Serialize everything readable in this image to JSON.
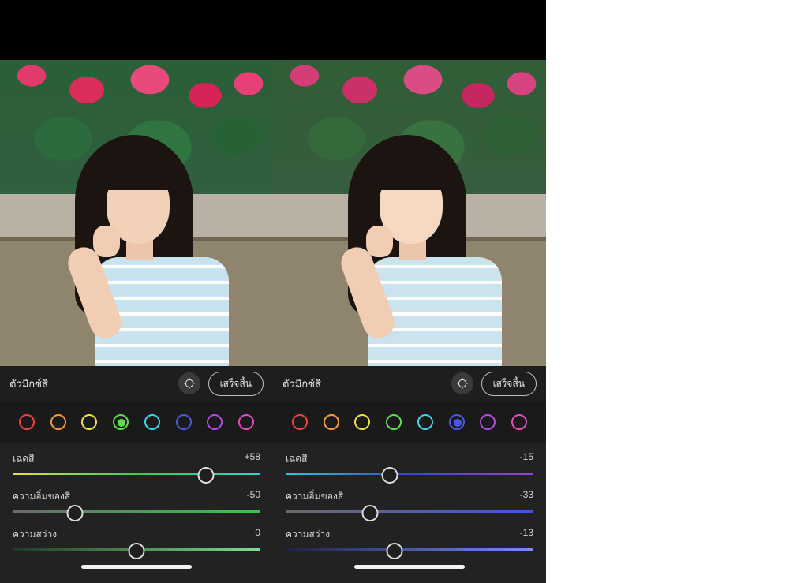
{
  "panes": [
    {
      "title": "ตัวมิกซ์สี",
      "done_label": "เสร็จสิ้น",
      "swatches": [
        {
          "color": "#f04040"
        },
        {
          "color": "#f2993c"
        },
        {
          "color": "#f2e03c"
        },
        {
          "color": "#5edc4e",
          "selected": true,
          "dot": "#5edc4e"
        },
        {
          "color": "#3cd4e6"
        },
        {
          "color": "#4b59e0"
        },
        {
          "color": "#b24be0"
        },
        {
          "color": "#e24bc0"
        }
      ],
      "sliders": [
        {
          "label": "เฉดสี",
          "value": "+58",
          "pos": 78,
          "grad": "linear-gradient(90deg,#e3e23a,#32d04e,#2ed0d0)"
        },
        {
          "label": "ความอิ่มของสี",
          "value": "-50",
          "pos": 25,
          "grad": "linear-gradient(90deg,#6a6a6a,#33c84a)"
        },
        {
          "label": "ความสว่าง",
          "value": "0",
          "pos": 50,
          "grad": "linear-gradient(90deg,#1f3a24,#7de08d)"
        }
      ]
    },
    {
      "title": "ตัวมิกซ์สี",
      "done_label": "เสร็จสิ้น",
      "swatches": [
        {
          "color": "#f04040"
        },
        {
          "color": "#f2993c"
        },
        {
          "color": "#f2e03c"
        },
        {
          "color": "#5edc4e"
        },
        {
          "color": "#3cd4e6"
        },
        {
          "color": "#4b59e0",
          "selected": true,
          "dot": "#4b59e0"
        },
        {
          "color": "#b24be0"
        },
        {
          "color": "#e24bc0"
        }
      ],
      "sliders": [
        {
          "label": "เฉดสี",
          "value": "-15",
          "pos": 42,
          "grad": "linear-gradient(90deg,#27c9d7,#3747d6,#9a3fd6)"
        },
        {
          "label": "ความอิ่มของสี",
          "value": "-33",
          "pos": 34,
          "grad": "linear-gradient(90deg,#6a6a6a,#4053e0)"
        },
        {
          "label": "ความสว่าง",
          "value": "-13",
          "pos": 44,
          "grad": "linear-gradient(90deg,#1c2148,#7a8bff)"
        }
      ]
    }
  ]
}
